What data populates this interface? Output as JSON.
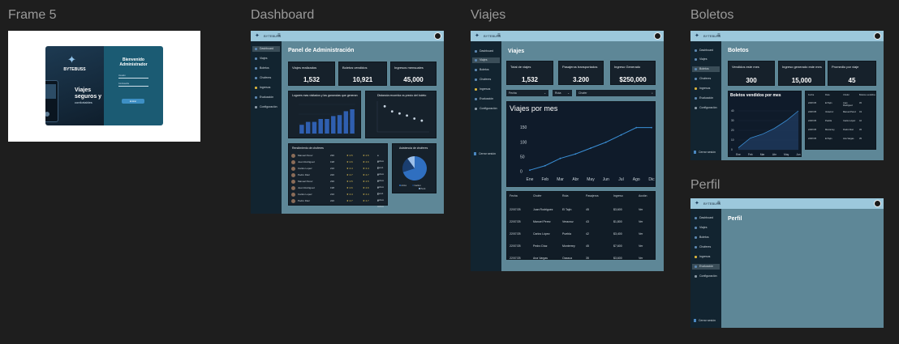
{
  "frames": {
    "frame5": {
      "title": "Frame 5",
      "login": {
        "brand": "BYTEBUSS",
        "slogan_line1": "Viajes",
        "slogan_line2": "seguros y",
        "slogan_line3": "confortables",
        "welcome_line1": "Bienvenido",
        "welcome_line2": "Administrador",
        "user_label": "Usuario",
        "pass_label": "Contraseña",
        "submit_label": "Entrar"
      }
    },
    "dashboard": {
      "title": "Dashboard",
      "page_title": "Panel de Administración",
      "cards": [
        {
          "label": "Viajes realizados",
          "value": "1,532"
        },
        {
          "label": "Boletos vendidos",
          "value": "10,921"
        },
        {
          "label": "Ingresos mensuales",
          "value": "45,000"
        }
      ],
      "bar_panel_title": "Lugares mas visitados y las ganancias que generan",
      "scatter_panel_title": "Distancia recorrida vs precio del boleto",
      "drivers_title": "Rendimiento de choferes",
      "drivers": [
        {
          "name": "Manuel Perez",
          "trips": "230",
          "rating": "4.5",
          "status": "Activo"
        },
        {
          "name": "Juan Rodriguez",
          "trips": "198",
          "rating": "4.6",
          "status": "Pend."
        },
        {
          "name": "Carlos Lopez",
          "trips": "210",
          "rating": "4.4",
          "status": "Activo"
        },
        {
          "name": "Pedro Diaz",
          "trips": "220",
          "rating": "4.7",
          "status": "Activo"
        },
        {
          "name": "Manuel Perez",
          "trips": "230",
          "rating": "4.5",
          "status": "Activo"
        },
        {
          "name": "Juan Rodriguez",
          "trips": "198",
          "rating": "4.6",
          "status": "Pend."
        },
        {
          "name": "Carlos Lopez",
          "trips": "210",
          "rating": "4.4",
          "status": "Activo"
        },
        {
          "name": "Pedro Diaz",
          "trips": "220",
          "rating": "4.7",
          "status": "Activo"
        }
      ],
      "pie_title": "Asistencia de choferes",
      "pie_legend": [
        "Activo",
        "Inactivo",
        "Pend."
      ]
    },
    "viajes": {
      "title": "Viajes",
      "page_title": "Viajes",
      "cards": [
        {
          "label": "Total de viajes",
          "value": "1,532"
        },
        {
          "label": "Pasajeros transportados",
          "value": "3.200"
        },
        {
          "label": "Ingreso Generado",
          "value": "$250,000"
        }
      ],
      "filter_fecha": "Fecha",
      "filter_ruta": "Ruta",
      "filter_chofer": "Chofer",
      "chart_title": "Viajes por mes",
      "table_headers": [
        "Fecha",
        "Chofer",
        "Ruta",
        "Pasajeros",
        "Ingreso",
        "Acción"
      ],
      "rows": [
        [
          "22/07/25",
          "Juan Rodriguez",
          "El Tajín",
          "45",
          "$3,600",
          "Ver"
        ],
        [
          "22/07/25",
          "Manuel Perez",
          "Veracruz",
          "43",
          "$1,800",
          "Ver"
        ],
        [
          "22/07/25",
          "Carlos López",
          "Puebla",
          "42",
          "$3,400",
          "Ver"
        ],
        [
          "22/07/25",
          "Pedro Díaz",
          "Monterrey",
          "45",
          "$7,600",
          "Ver"
        ],
        [
          "22/07/25",
          "Ana Vargas",
          "Oaxaca",
          "35",
          "$3,600",
          "Ver"
        ]
      ]
    },
    "boletos": {
      "title": "Boletos",
      "page_title": "Boletos",
      "cards": [
        {
          "label": "Vendidos este mes",
          "value": "300"
        },
        {
          "label": "Ingreso generado este mes",
          "value": "15,000"
        },
        {
          "label": "Promedio por viaje",
          "value": "45"
        }
      ],
      "chart_title": "Boletos vendidos por mes",
      "table_headers": [
        "Fecha",
        "Ruta",
        "Chofer",
        "Boletos vendidos"
      ],
      "rows": [
        [
          "22/07/25",
          "El Tajín",
          "Juan Rodríguez",
          "45"
        ],
        [
          "22/07/25",
          "Veracruz",
          "Manuel Perez",
          "43"
        ],
        [
          "22/07/25",
          "Puebla",
          "Carlos López",
          "42"
        ],
        [
          "22/07/25",
          "Monterrey",
          "Pedro Díaz",
          "45"
        ],
        [
          "22/07/25",
          "El Tajín",
          "Ana Vargas",
          "35"
        ]
      ]
    },
    "perfil": {
      "title": "Perfil",
      "page_title": "Perfil"
    }
  },
  "shared": {
    "brand_small": "BYTEBUSS",
    "sidebar": [
      "Dashboard",
      "Viajes",
      "Boletos",
      "Choferes",
      "Ingresos",
      "Evaluación",
      "Configuración"
    ],
    "logout": "Cerrar sesión"
  },
  "chart_data": [
    {
      "type": "bar",
      "categories": [
        "1",
        "2",
        "3",
        "4",
        "5",
        "6",
        "7",
        "8",
        "9"
      ],
      "values": [
        9,
        12,
        12,
        15,
        15,
        18,
        19,
        23,
        25
      ],
      "ylim": [
        0,
        30
      ]
    },
    {
      "type": "scatter",
      "x": [
        1,
        2,
        3,
        4,
        5,
        6
      ],
      "y": [
        5,
        4,
        3.6,
        3.2,
        2.6,
        2.2
      ]
    },
    {
      "type": "pie",
      "labels": [
        "Activo",
        "Inactivo",
        "Pend."
      ],
      "values": [
        70,
        20,
        10
      ]
    },
    {
      "type": "line",
      "title": "Viajes por mes",
      "categories": [
        "Ene",
        "Feb",
        "Mar",
        "Abr",
        "May",
        "Jun",
        "Jul",
        "Ago",
        "Dic"
      ],
      "values": [
        5,
        20,
        45,
        60,
        80,
        100,
        125,
        150,
        150
      ],
      "ylim": [
        0,
        160
      ],
      "yticks": [
        "0",
        "50",
        "100",
        "150"
      ]
    },
    {
      "type": "area",
      "title": "Boletos vendidos por mes",
      "categories": [
        "Ene",
        "Feb",
        "Mar",
        "Abr",
        "May",
        "Jun"
      ],
      "values": [
        2,
        12,
        16,
        22,
        30,
        40
      ],
      "ylim": [
        0,
        45
      ],
      "yticks": [
        "0",
        "10",
        "20",
        "30",
        "40"
      ]
    }
  ],
  "colors": {
    "canvas": "#1e1e1e",
    "topbar": "#9cc8dc",
    "sidebar": "#122430",
    "main": "#5e8797",
    "card": "#16212b",
    "bar": "#2f5fb0",
    "line": "#3a8fd6",
    "accent": "#3d8fc4"
  }
}
